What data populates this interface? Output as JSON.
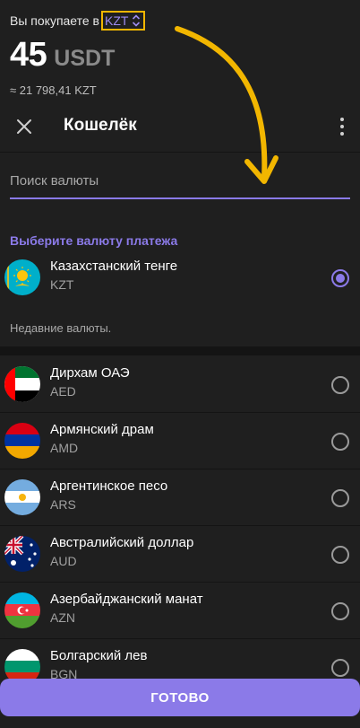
{
  "summary": {
    "buy_prefix": "Вы покупаете в",
    "currency": "KZT",
    "amount": "45",
    "amount_unit": "USDT",
    "approx": "≈ 21 798,41 KZT"
  },
  "header": {
    "title": "Кошелёк"
  },
  "search": {
    "placeholder": "Поиск валюты"
  },
  "selected": {
    "section_title": "Выберите валюту платежа",
    "item": {
      "name": "Казахстанский тенге",
      "code": "KZT",
      "flag_icon": "kazakhstan-flag-icon",
      "checked": true
    },
    "recent_note": "Недавние валюты."
  },
  "currencies": [
    {
      "name": "Дирхам ОАЭ",
      "code": "AED",
      "flag_icon": "uae-flag-icon"
    },
    {
      "name": "Армянский драм",
      "code": "AMD",
      "flag_icon": "armenia-flag-icon"
    },
    {
      "name": "Аргентинское песо",
      "code": "ARS",
      "flag_icon": "argentina-flag-icon"
    },
    {
      "name": "Австралийский доллар",
      "code": "AUD",
      "flag_icon": "australia-flag-icon"
    },
    {
      "name": "Азербайджанский манат",
      "code": "AZN",
      "flag_icon": "azerbaijan-flag-icon"
    },
    {
      "name": "Болгарский лев",
      "code": "BGN",
      "flag_icon": "bulgaria-flag-icon"
    }
  ],
  "done_button": "ГОТОВО",
  "colors": {
    "accent": "#8b7ae8",
    "highlight_box": "#f2b600",
    "background": "#1f1f1f"
  }
}
